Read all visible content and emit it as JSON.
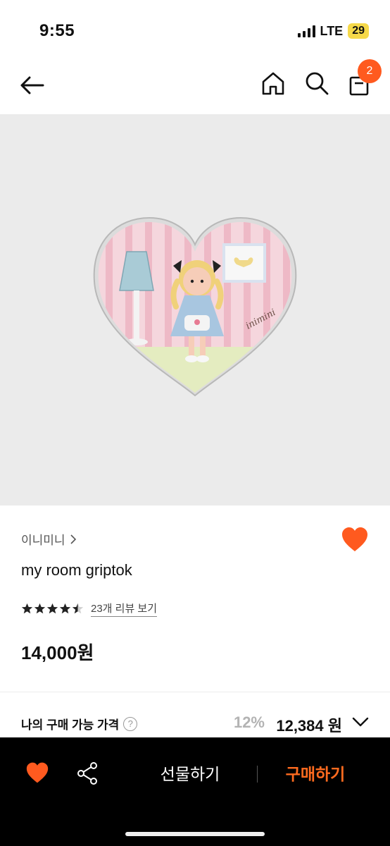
{
  "status_bar": {
    "time": "9:55",
    "network": "LTE",
    "battery": "29"
  },
  "nav": {
    "cart_count": "2"
  },
  "product": {
    "brand": "이니미니",
    "title": "my room griptok",
    "rating": 4.5,
    "review_link": "23개 리뷰 보기",
    "price": "14,000원",
    "image_text": "inimini"
  },
  "my_price": {
    "label": "나의 구매 가능 가격",
    "help": "?",
    "discount": "12%",
    "price": "12,384 원"
  },
  "action_bar": {
    "gift_label": "선물하기",
    "buy_label": "구매하기"
  },
  "colors": {
    "accent": "#ff5a1f",
    "buy": "#ff6b1f",
    "bar_bg": "#000000",
    "image_bg": "#ebebeb"
  }
}
